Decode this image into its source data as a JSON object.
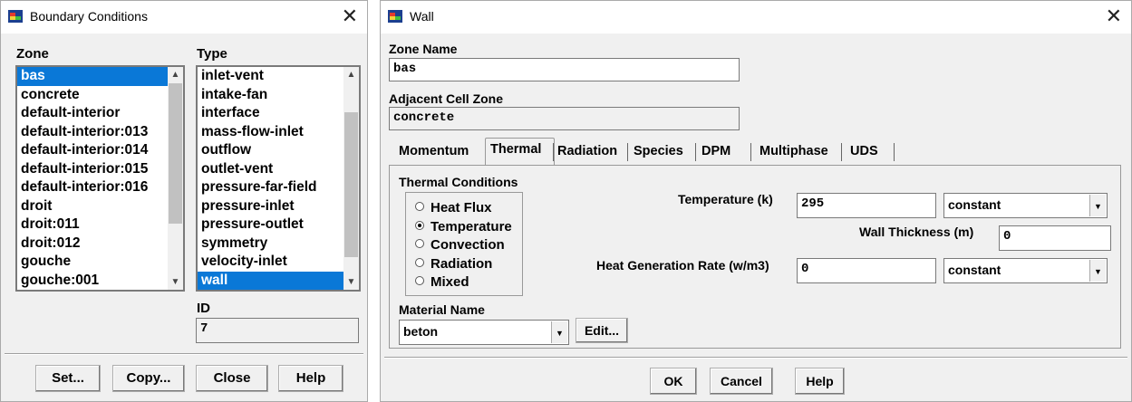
{
  "bc": {
    "title": "Boundary Conditions",
    "zone_label": "Zone",
    "type_label": "Type",
    "zones": [
      "bas",
      "concrete",
      "default-interior",
      "default-interior:013",
      "default-interior:014",
      "default-interior:015",
      "default-interior:016",
      "droit",
      "droit:011",
      "droit:012",
      "gouche",
      "gouche:001"
    ],
    "types": [
      "inlet-vent",
      "intake-fan",
      "interface",
      "mass-flow-inlet",
      "outflow",
      "outlet-vent",
      "pressure-far-field",
      "pressure-inlet",
      "pressure-outlet",
      "symmetry",
      "velocity-inlet",
      "wall"
    ],
    "id_label": "ID",
    "id_value": "7",
    "buttons": {
      "set": "Set...",
      "copy": "Copy...",
      "close": "Close",
      "help": "Help"
    }
  },
  "wall": {
    "title": "Wall",
    "zone_name_label": "Zone Name",
    "zone_name_value": "bas",
    "adjacent_label": "Adjacent Cell Zone",
    "adjacent_value": "concrete",
    "tabs": [
      "Momentum",
      "Thermal",
      "Radiation",
      "Species",
      "DPM",
      "Multiphase",
      "UDS"
    ],
    "thermal_conditions_label": "Thermal Conditions",
    "radios": [
      "Heat Flux",
      "Temperature",
      "Convection",
      "Radiation",
      "Mixed"
    ],
    "temperature_label": "Temperature (k)",
    "temperature_value": "295",
    "temperature_method": "constant",
    "wall_thickness_label": "Wall Thickness (m)",
    "wall_thickness_value": "0",
    "heat_gen_label": "Heat Generation Rate (w/m3)",
    "heat_gen_value": "0",
    "heat_gen_method": "constant",
    "material_name_label": "Material Name",
    "material_value": "beton",
    "edit_label": "Edit...",
    "buttons": {
      "ok": "OK",
      "cancel": "Cancel",
      "help": "Help"
    }
  }
}
